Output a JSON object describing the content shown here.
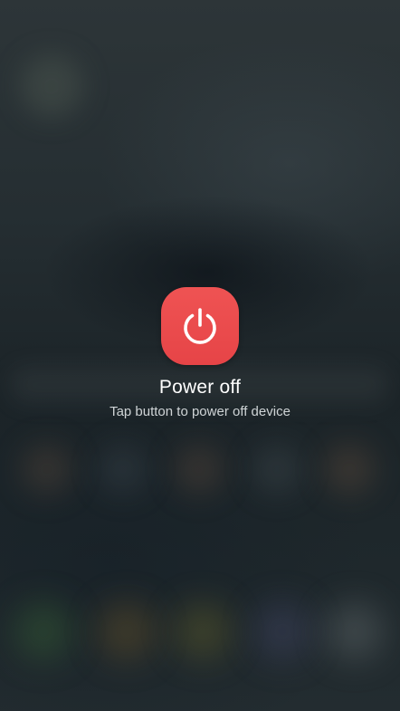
{
  "power_off": {
    "title": "Power off",
    "subtitle": "Tap button to power off device",
    "button_color": "#e84a4c",
    "icon": "power-icon"
  }
}
